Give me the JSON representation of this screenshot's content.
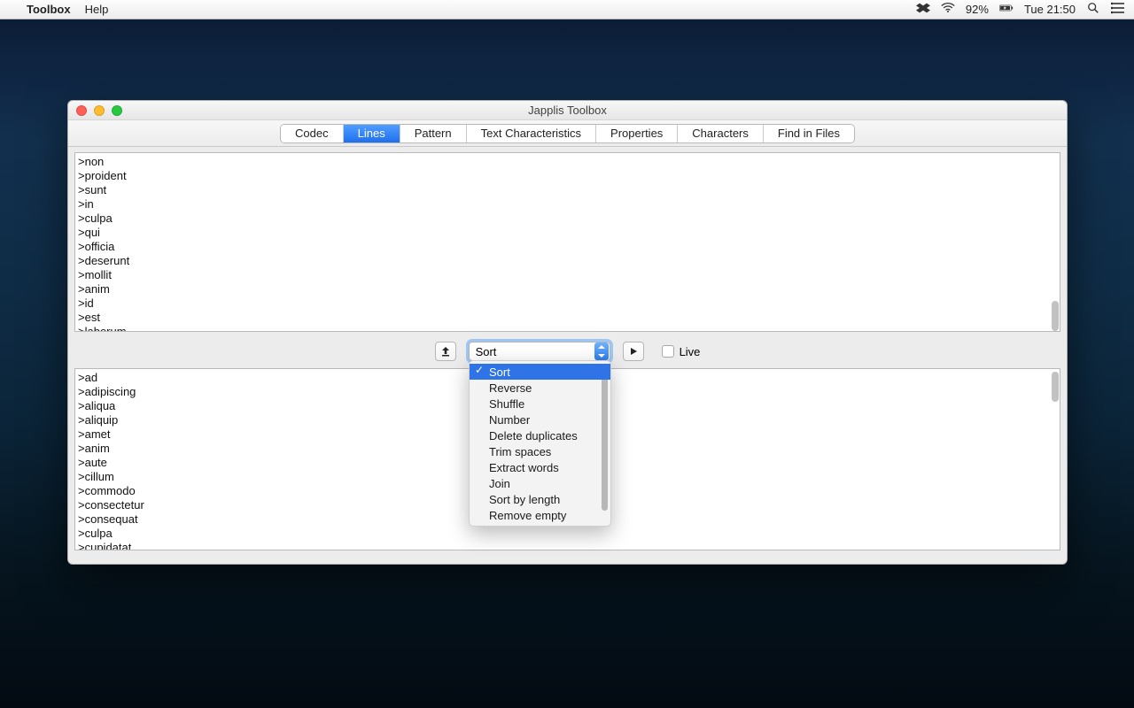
{
  "menubar": {
    "app": "Toolbox",
    "menus": [
      "Help"
    ],
    "battery": "92%",
    "clock": "Tue 21:50"
  },
  "window": {
    "title": "Japplis Toolbox",
    "tabs": [
      "Codec",
      "Lines",
      "Pattern",
      "Text Characteristics",
      "Properties",
      "Characters",
      "Find in Files"
    ],
    "active_tab": "Lines"
  },
  "input_lines": [
    ">non",
    ">proident",
    ">sunt",
    ">in",
    ">culpa",
    ">qui",
    ">officia",
    ">deserunt",
    ">mollit",
    ">anim",
    ">id",
    ">est",
    ">laborum"
  ],
  "output_lines": [
    ">ad",
    ">adipiscing",
    ">aliqua",
    ">aliquip",
    ">amet",
    ">anim",
    ">aute",
    ">cillum",
    ">commodo",
    ">consectetur",
    ">consequat",
    ">culpa",
    ">cupidatat"
  ],
  "controls": {
    "operation_selected": "Sort",
    "live_label": "Live",
    "operations": [
      "Sort",
      "Reverse",
      "Shuffle",
      "Number",
      "Delete duplicates",
      "Trim spaces",
      "Extract words",
      "Join",
      "Sort by length",
      "Remove empty"
    ]
  }
}
